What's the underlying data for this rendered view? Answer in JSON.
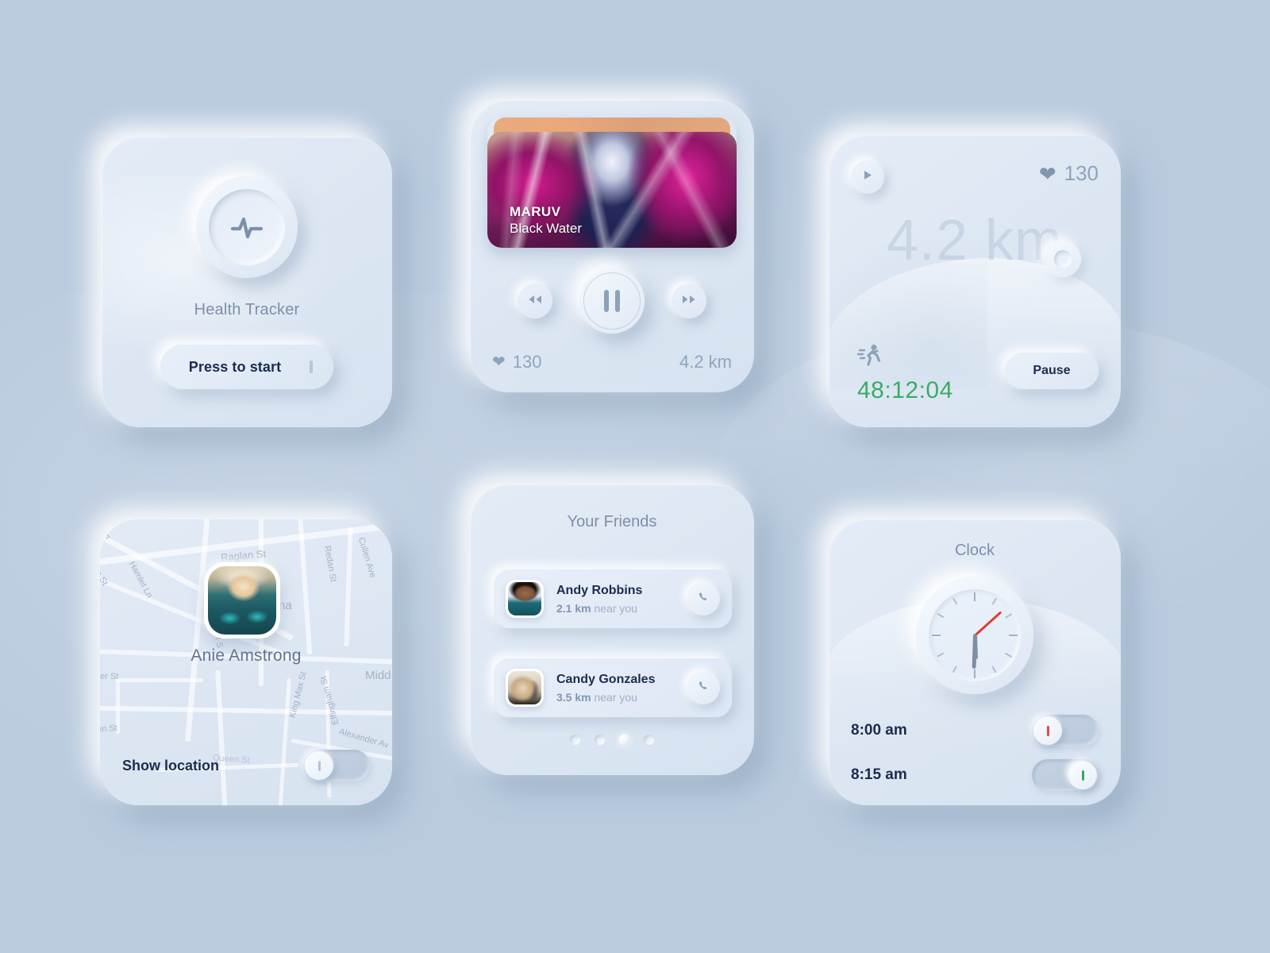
{
  "theme": {
    "background": "#bacbdf",
    "card_bg": "#e0eaf5",
    "text_dark": "#1c2c4c",
    "text_muted": "#7e8fa8",
    "accent_green": "#3cab67",
    "accent_red": "#e8473f"
  },
  "health_card": {
    "icon": "pulse-icon",
    "caption": "Health Tracker",
    "button_label": "Press to start"
  },
  "music_card": {
    "artist": "MARUV",
    "track": "Black Water",
    "prev_icon": "rewind-icon",
    "play_state_icon": "pause-icon",
    "next_icon": "fast-forward-icon",
    "heart_icon": "heart-icon",
    "heart_rate": "130",
    "distance": "4.2 km"
  },
  "run_card": {
    "play_icon": "play-icon",
    "heart_icon": "heart-icon",
    "heart_rate": "130",
    "distance": "4.2 km",
    "run_icon": "running-icon",
    "elapsed": "48:12:04",
    "pause_label": "Pause"
  },
  "map_card": {
    "person_name": "Anie Amstrong",
    "toggle_label": "Show location",
    "toggle_state": "off",
    "streets": [
      "rd",
      "Hamlet Ln",
      "n St",
      "Raglan St",
      "Prince Albert S",
      "Redan St",
      "Cullen Ave",
      "na",
      "ner St",
      "Midd",
      "King Max St",
      "Effingham St",
      "Alexander Av",
      "Queen St",
      "een St"
    ]
  },
  "friends_card": {
    "title": "Your Friends",
    "call_icon": "phone-icon",
    "friends": [
      {
        "name": "Andy Robbins",
        "distance": "2.1 km",
        "suffix": "near you"
      },
      {
        "name": "Candy Gonzales",
        "distance": "3.5 km",
        "suffix": "near you"
      }
    ],
    "pagination": {
      "count": 4,
      "active_index": 2
    }
  },
  "clock_card": {
    "title": "Clock",
    "clock": {
      "hour_deg": 178,
      "minute_deg": 182,
      "second_deg": 48
    },
    "alarms": [
      {
        "time": "8:00 am",
        "state": "off",
        "marker_color": "#e8473f"
      },
      {
        "time": "8:15 am",
        "state": "on",
        "marker_color": "#35a860"
      }
    ]
  }
}
